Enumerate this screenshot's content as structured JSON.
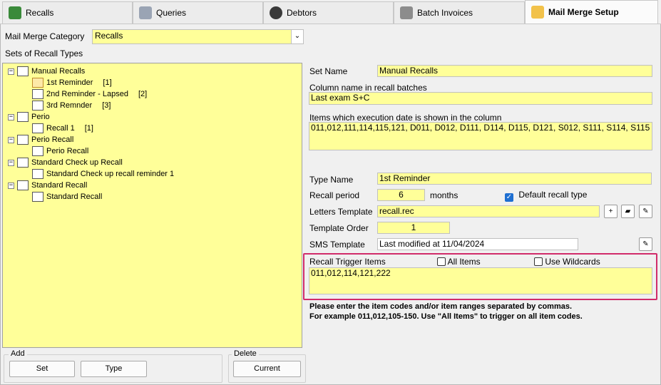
{
  "tabs": [
    {
      "label": "Recalls",
      "icon": "recalls-icon",
      "color": "#3a8a3a"
    },
    {
      "label": "Queries",
      "icon": "queries-icon",
      "color": "#9aa4b4"
    },
    {
      "label": "Debtors",
      "icon": "debtors-icon",
      "color": "#3a3a3a"
    },
    {
      "label": "Batch Invoices",
      "icon": "batch-invoices-icon",
      "color": "#8c8c8c"
    },
    {
      "label": "Mail Merge Setup",
      "icon": "mail-merge-icon",
      "color": "#f2c24a"
    }
  ],
  "category": {
    "label": "Mail Merge Category",
    "value": "Recalls"
  },
  "sets_label": "Sets of Recall Types",
  "tree": [
    {
      "text": "Manual Recalls",
      "level": 0,
      "badge": ""
    },
    {
      "text": "1st Reminder",
      "level": 1,
      "badge": "[1]"
    },
    {
      "text": "2nd Reminder - Lapsed",
      "level": 1,
      "badge": "[2]"
    },
    {
      "text": "3rd Remnder",
      "level": 1,
      "badge": "[3]"
    },
    {
      "text": "Perio",
      "level": 0,
      "badge": ""
    },
    {
      "text": "Recall 1",
      "level": 1,
      "badge": "[1]"
    },
    {
      "text": "Perio Recall",
      "level": 0,
      "badge": ""
    },
    {
      "text": "Perio Recall",
      "level": 1,
      "badge": ""
    },
    {
      "text": "Standard Check up Recall",
      "level": 0,
      "badge": ""
    },
    {
      "text": "Standard Check up recall reminder 1",
      "level": 1,
      "badge": ""
    },
    {
      "text": "Standard Recall",
      "level": 0,
      "badge": ""
    },
    {
      "text": "Standard Recall",
      "level": 1,
      "badge": ""
    }
  ],
  "add_group": {
    "title": "Add",
    "set": "Set",
    "type": "Type"
  },
  "delete_group": {
    "title": "Delete",
    "current": "Current"
  },
  "form": {
    "set_name_label": "Set Name",
    "set_name": "Manual Recalls",
    "column_label": "Column name in recall batches",
    "column_value": "Last exam S+C",
    "items_label": "Items which execution date is shown in the column",
    "items_value": "011,012,111,114,115,121, D011, D012, D111, D114, D115, D121, S012, S111, S114, S115",
    "type_name_label": "Type Name",
    "type_name": "1st Reminder",
    "recall_period_label": "Recall period",
    "recall_period": "6",
    "months_label": "months",
    "default_recall_label": "Default recall type",
    "letters_label": "Letters Template",
    "letters_value": "recall.rec",
    "order_label": "Template Order",
    "order_value": "1",
    "sms_label": "SMS Template",
    "sms_value": "Last modified at 11/04/2024",
    "trigger_label": "Recall Trigger Items",
    "all_items_label": "All Items",
    "wildcards_label": "Use Wildcards",
    "trigger_value": "011,012,114,121,222",
    "hint1": "Please enter the item codes and/or item ranges separated by commas.",
    "hint2": "For example 011,012,105-150. Use \"All Items\" to trigger on all item codes."
  },
  "colors": {
    "field": "#ffff99",
    "highlight": "#d12c6a",
    "checkbox": "#1f6fd1"
  }
}
